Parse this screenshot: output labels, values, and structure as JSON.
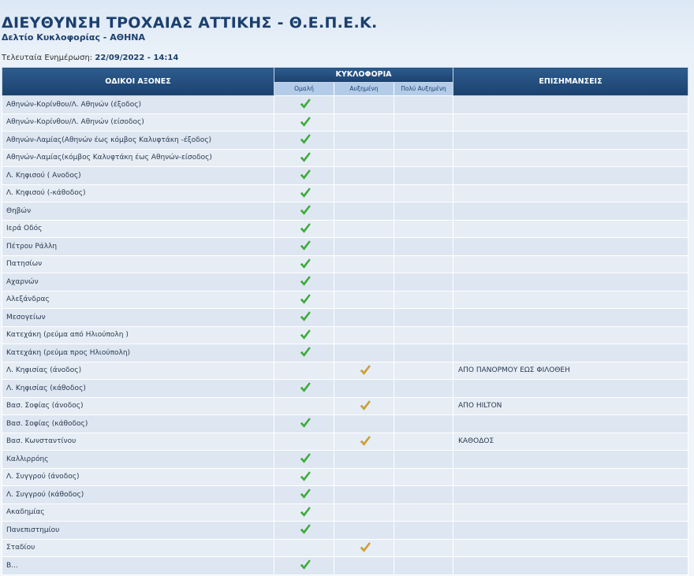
{
  "header": {
    "title": "ΔΙΕΥΘΥΝΣΗ ΤΡΟΧΑΙΑΣ ΑΤΤΙΚΗΣ - Θ.Ε.Π.Ε.Κ.",
    "subtitle": "Δελτίο Κυκλοφορίας - ΑΘΗΝΑ",
    "updated_label": "Τελευταία Ενημέρωση:",
    "updated_value": "22/09/2022 - 14:14"
  },
  "table": {
    "col_roads": "ΟΔΙΚΟΙ ΑΞΟΝΕΣ",
    "col_traffic": "ΚΥΚΛΟΦΟΡΙΑ",
    "col_notes": "ΕΠΙΣΗΜΑΝΣΕΙΣ",
    "sub_normal": "Ομαλή",
    "sub_increased": "Αυξημένη",
    "sub_very": "Πολύ Αυξημένη",
    "colors": {
      "normal_check": "#2fb52a",
      "increased_check": "#d9a21d"
    },
    "rows": [
      {
        "road": "Αθηνών-Κορίνθου/Λ. Αθηνών (έξοδος)",
        "status": "normal",
        "note": ""
      },
      {
        "road": "Αθηνών-Κορίνθου/Λ. Αθηνών (είσοδος)",
        "status": "normal",
        "note": ""
      },
      {
        "road": "Αθηνών-Λαμίας(Αθηνών έως κόμβος Καλυφτάκη -έξοδος)",
        "status": "normal",
        "note": ""
      },
      {
        "road": "Αθηνών-Λαμίας(κόμβος Καλυφτάκη έως Αθηνών-είσοδος)",
        "status": "normal",
        "note": ""
      },
      {
        "road": "Λ. Κηφισού ( Ανοδος)",
        "status": "normal",
        "note": ""
      },
      {
        "road": "Λ. Κηφισού (-κάθοδος)",
        "status": "normal",
        "note": ""
      },
      {
        "road": "Θηβών",
        "status": "normal",
        "note": ""
      },
      {
        "road": "Ιερά Οδός",
        "status": "normal",
        "note": ""
      },
      {
        "road": "Πέτρου Ράλλη",
        "status": "normal",
        "note": ""
      },
      {
        "road": "Πατησίων",
        "status": "normal",
        "note": ""
      },
      {
        "road": "Αχαρνών",
        "status": "normal",
        "note": ""
      },
      {
        "road": "Αλεξάνδρας",
        "status": "normal",
        "note": ""
      },
      {
        "road": "Μεσογείων",
        "status": "normal",
        "note": ""
      },
      {
        "road": "Κατεχάκη (ρεύμα από Ηλιούπολη )",
        "status": "normal",
        "note": ""
      },
      {
        "road": "Κατεχάκη (ρεύμα προς Ηλιούπολη)",
        "status": "normal",
        "note": ""
      },
      {
        "road": "Λ. Κηφισίας (άνοδος)",
        "status": "increased",
        "note": "ΑΠΟ ΠΑΝΟΡΜΟΥ ΕΩΣ ΦΙΛΟΘΕΗ"
      },
      {
        "road": "Λ. Κηφισίας (κάθοδος)",
        "status": "normal",
        "note": ""
      },
      {
        "road": "Βασ. Σοφίας (άνοδος)",
        "status": "increased",
        "note": "ΑΠΟ HILTON"
      },
      {
        "road": "Βασ. Σοφίας (κάθοδος)",
        "status": "normal",
        "note": ""
      },
      {
        "road": "Βασ. Κωνσταντίνου",
        "status": "increased",
        "note": "ΚΑΘΟΔΟΣ"
      },
      {
        "road": "Καλλιρρόης",
        "status": "normal",
        "note": ""
      },
      {
        "road": "Λ. Συγγρού (άνοδος)",
        "status": "normal",
        "note": ""
      },
      {
        "road": "Λ. Συγγρού (κάθοδος)",
        "status": "normal",
        "note": ""
      },
      {
        "road": "Ακαδημίας",
        "status": "normal",
        "note": ""
      },
      {
        "road": "Πανεπιστημίου",
        "status": "normal",
        "note": ""
      },
      {
        "road": "Σταδίου",
        "status": "increased",
        "note": ""
      },
      {
        "road": "Β...",
        "status": "normal",
        "note": ""
      }
    ]
  }
}
